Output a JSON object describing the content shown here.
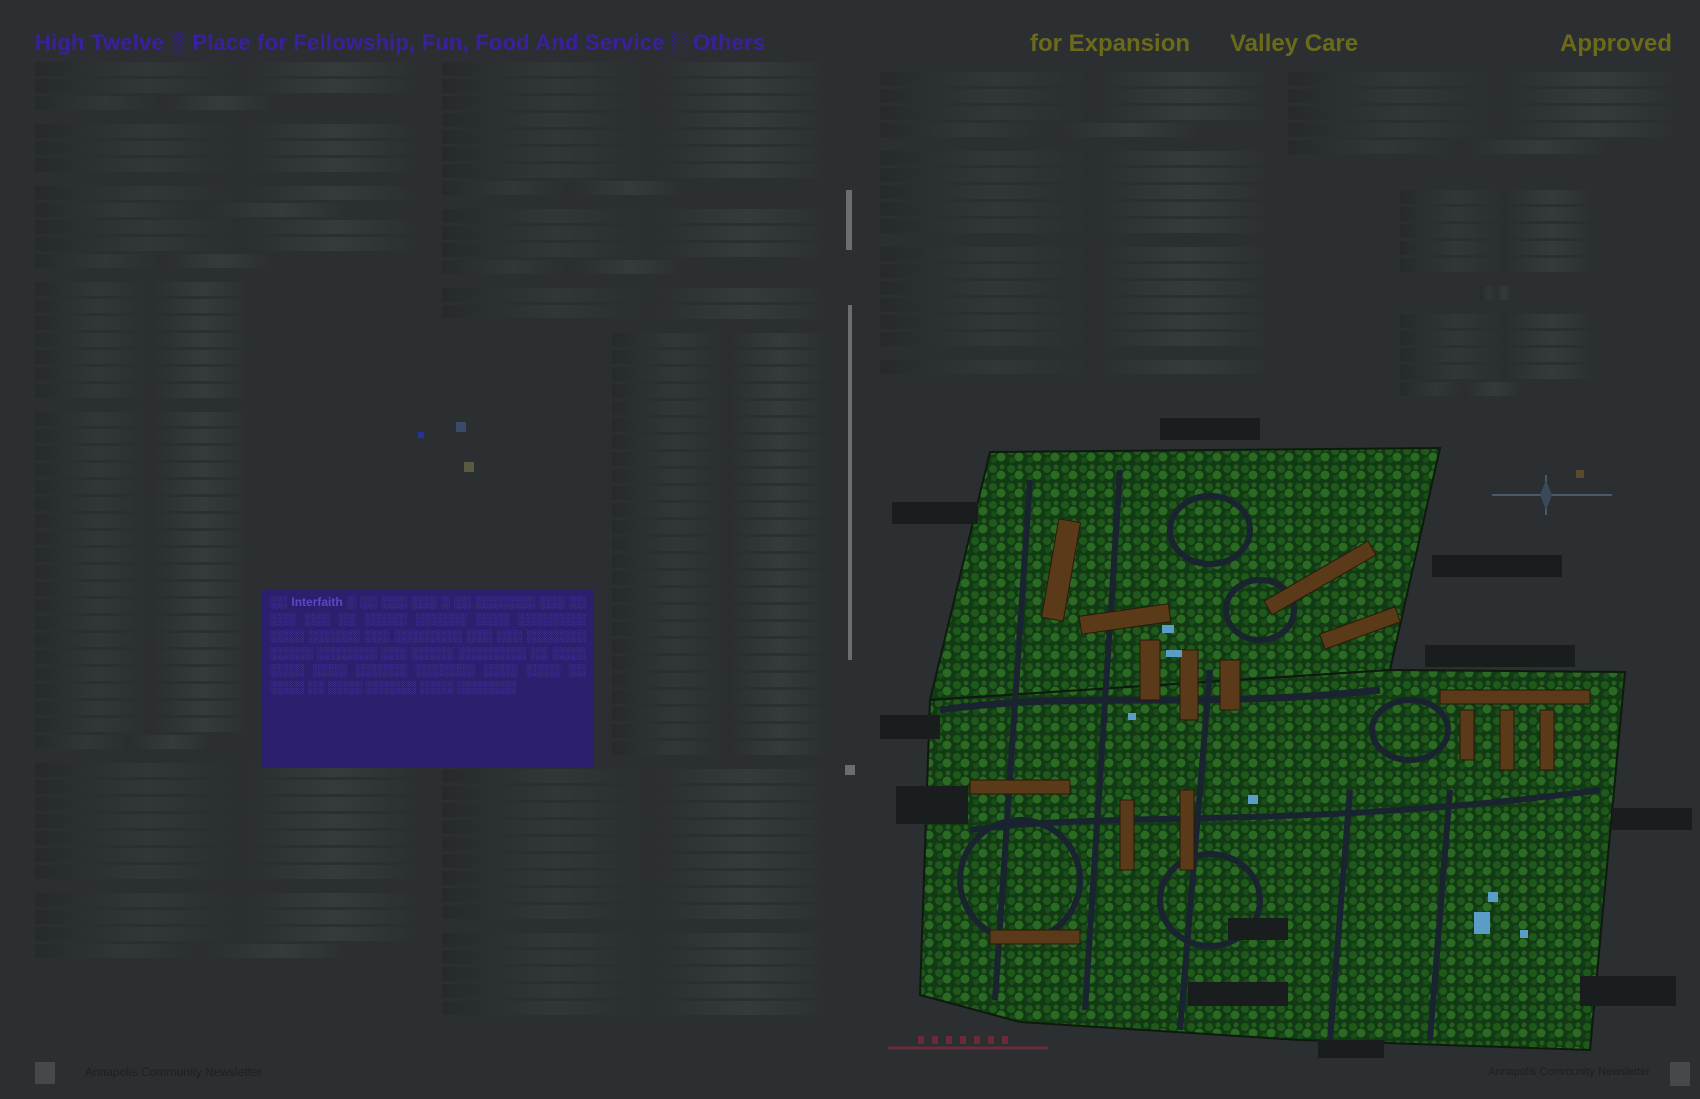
{
  "headline": {
    "left": "High Twelve ░ Place for Fellowship, Fun, Food And Service ░ Others",
    "right_a": "for Expansion",
    "right_b": "Valley Care",
    "right_c": "Approved"
  },
  "caption_box": {
    "text": "░░ Interfaith ░ ░░ ░░░ ░░░ ░ ░░ ░░░░░░░ ░░░ ░░ ░░░ ░░░ ░░ ░░░░░ ░░░░░░ ░░░░ ░░░░░░░░ ░░░░ ░░░░░░ ░░░ ░░░░░░░░ ░░░ ░░░ ░░░░░░░ ░░░░░ ░░░░░░░ ░░░ ░░░░░ ░░░░░░░░ ░░ ░░░░ ░░░░ ░░░░ ░░░░░░ ░░░░░░░ ░░░░ ░░░░ ░░ ░░░░ ░░ ░░░░ ░░░░░░ ░░░░ ░░░░░░░"
  },
  "footer": {
    "left": "Annapolis Community Newsletter",
    "right": "Annapolis Community Newsletter"
  },
  "siteplan": {
    "labels": [
      "",
      "",
      "",
      "",
      "",
      "",
      "",
      "",
      "",
      "",
      ""
    ]
  },
  "colors": {
    "background": "#2b2f31",
    "headline_left": "#3a1fa0",
    "headline_right": "#6b6a1a",
    "caption_bg": "#2c1f6e",
    "plan_green": "#1f5a1a",
    "plan_brown": "#5a3a18",
    "plan_blue": "#5a9ec8"
  }
}
